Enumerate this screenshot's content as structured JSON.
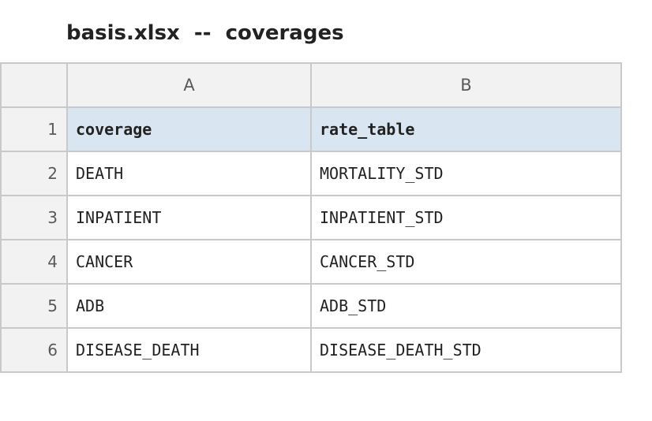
{
  "window": {
    "title": "basis.xlsx  --  coverages"
  },
  "sheet": {
    "columns": [
      "A",
      "B"
    ],
    "rows": [
      {
        "num": "1",
        "cells": [
          "coverage",
          "rate_table"
        ]
      },
      {
        "num": "2",
        "cells": [
          "DEATH",
          "MORTALITY_STD"
        ]
      },
      {
        "num": "3",
        "cells": [
          "INPATIENT",
          "INPATIENT_STD"
        ]
      },
      {
        "num": "4",
        "cells": [
          "CANCER",
          "CANCER_STD"
        ]
      },
      {
        "num": "5",
        "cells": [
          "ADB",
          "ADB_STD"
        ]
      },
      {
        "num": "6",
        "cells": [
          "DISEASE_DEATH",
          "DISEASE_DEATH_STD"
        ]
      }
    ],
    "colors": {
      "header_fill": "#d9e5f1",
      "heading_fill": "#f2f2f2",
      "grid": "#c9c9c9"
    }
  }
}
